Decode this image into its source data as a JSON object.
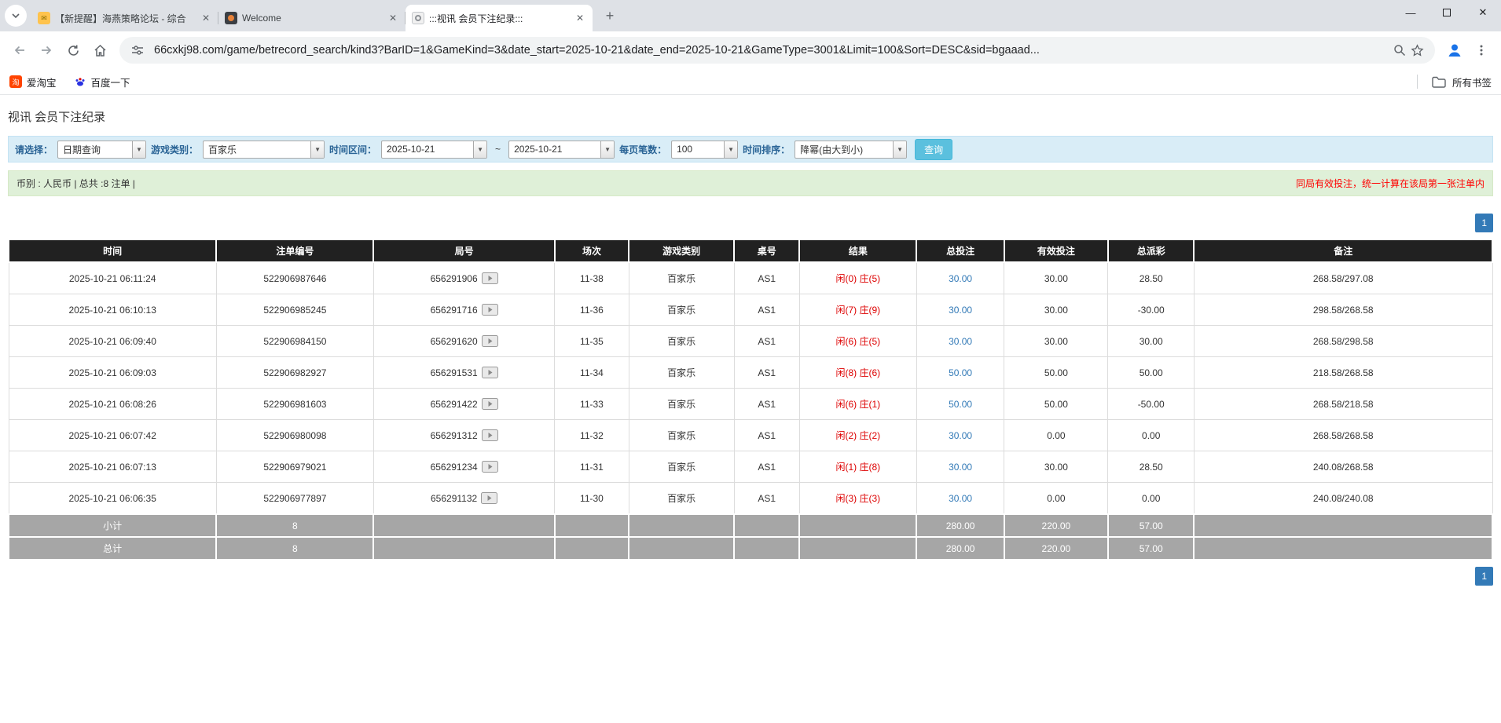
{
  "browser": {
    "tabs": [
      {
        "title": "【新提醒】海燕策略论坛 - 综合",
        "active": false
      },
      {
        "title": "Welcome",
        "active": false
      },
      {
        "title": ":::视讯 会员下注纪录:::",
        "active": true
      }
    ],
    "url": "66cxkj98.com/game/betrecord_search/kind3?BarID=1&GameKind=3&date_start=2025-10-21&date_end=2025-10-21&GameType=3001&Limit=100&Sort=DESC&sid=bgaaad...",
    "bookmarks": [
      {
        "label": "爱淘宝"
      },
      {
        "label": "百度一下"
      }
    ],
    "bookmarks_right_label": "所有书签"
  },
  "page": {
    "title": "视讯 会员下注纪录",
    "filters": {
      "select_label": "请选择：",
      "select_value": "日期查询",
      "game_type_label": "游戏类别：",
      "game_type_value": "百家乐",
      "date_range_label": "时间区间：",
      "date_start": "2025-10-21",
      "date_separator": "~",
      "date_end": "2025-10-21",
      "page_size_label": "每页笔数：",
      "page_size_value": "100",
      "sort_label": "时间排序：",
      "sort_value": "降幂(由大到小)",
      "search_button": "查询"
    },
    "summary": {
      "left": "币别 : 人民币 | 总共 :8 注单 |",
      "right": "同局有效投注，统一计算在该局第一张注单内"
    },
    "pagination": "1",
    "table": {
      "headers": [
        "时间",
        "注单编号",
        "局号",
        "场次",
        "游戏类别",
        "桌号",
        "结果",
        "总投注",
        "有效投注",
        "总派彩",
        "备注"
      ],
      "rows": [
        {
          "time": "2025-10-21 06:11:24",
          "bet_no": "522906987646",
          "round_no": "656291906",
          "session": "11-38",
          "game": "百家乐",
          "table_no": "AS1",
          "result_p": "闲(0)",
          "result_b": "庄(5)",
          "total_bet": "30.00",
          "valid_bet": "30.00",
          "payout": "28.50",
          "note": "268.58/297.08"
        },
        {
          "time": "2025-10-21 06:10:13",
          "bet_no": "522906985245",
          "round_no": "656291716",
          "session": "11-36",
          "game": "百家乐",
          "table_no": "AS1",
          "result_p": "闲(7)",
          "result_b": "庄(9)",
          "total_bet": "30.00",
          "valid_bet": "30.00",
          "payout": "-30.00",
          "note": "298.58/268.58"
        },
        {
          "time": "2025-10-21 06:09:40",
          "bet_no": "522906984150",
          "round_no": "656291620",
          "session": "11-35",
          "game": "百家乐",
          "table_no": "AS1",
          "result_p": "闲(6)",
          "result_b": "庄(5)",
          "total_bet": "30.00",
          "valid_bet": "30.00",
          "payout": "30.00",
          "note": "268.58/298.58"
        },
        {
          "time": "2025-10-21 06:09:03",
          "bet_no": "522906982927",
          "round_no": "656291531",
          "session": "11-34",
          "game": "百家乐",
          "table_no": "AS1",
          "result_p": "闲(8)",
          "result_b": "庄(6)",
          "total_bet": "50.00",
          "valid_bet": "50.00",
          "payout": "50.00",
          "note": "218.58/268.58"
        },
        {
          "time": "2025-10-21 06:08:26",
          "bet_no": "522906981603",
          "round_no": "656291422",
          "session": "11-33",
          "game": "百家乐",
          "table_no": "AS1",
          "result_p": "闲(6)",
          "result_b": "庄(1)",
          "total_bet": "50.00",
          "valid_bet": "50.00",
          "payout": "-50.00",
          "note": "268.58/218.58"
        },
        {
          "time": "2025-10-21 06:07:42",
          "bet_no": "522906980098",
          "round_no": "656291312",
          "session": "11-32",
          "game": "百家乐",
          "table_no": "AS1",
          "result_p": "闲(2)",
          "result_b": "庄(2)",
          "total_bet": "30.00",
          "valid_bet": "0.00",
          "payout": "0.00",
          "note": "268.58/268.58"
        },
        {
          "time": "2025-10-21 06:07:13",
          "bet_no": "522906979021",
          "round_no": "656291234",
          "session": "11-31",
          "game": "百家乐",
          "table_no": "AS1",
          "result_p": "闲(1)",
          "result_b": "庄(8)",
          "total_bet": "30.00",
          "valid_bet": "30.00",
          "payout": "28.50",
          "note": "240.08/268.58"
        },
        {
          "time": "2025-10-21 06:06:35",
          "bet_no": "522906977897",
          "round_no": "656291132",
          "session": "11-30",
          "game": "百家乐",
          "table_no": "AS1",
          "result_p": "闲(3)",
          "result_b": "庄(3)",
          "total_bet": "30.00",
          "valid_bet": "0.00",
          "payout": "0.00",
          "note": "240.08/240.08"
        }
      ],
      "subtotal": {
        "label": "小计",
        "count": "8",
        "total_bet": "280.00",
        "valid_bet": "220.00",
        "payout": "57.00"
      },
      "total": {
        "label": "总计",
        "count": "8",
        "total_bet": "280.00",
        "valid_bet": "220.00",
        "payout": "57.00"
      }
    }
  }
}
